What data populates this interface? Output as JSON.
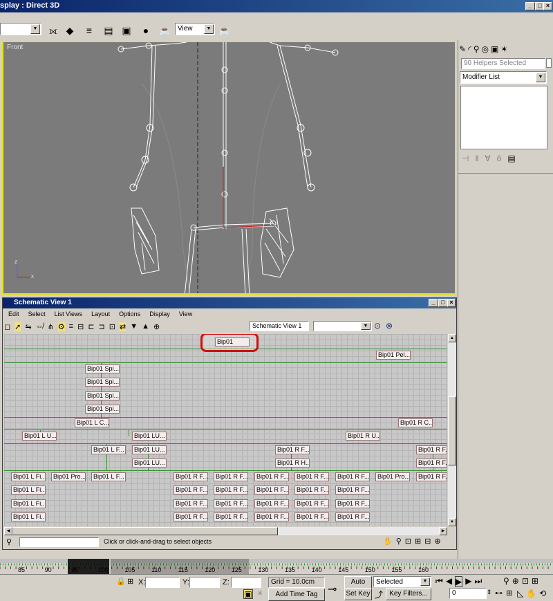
{
  "window": {
    "title": "splay : Direct 3D"
  },
  "toolbar": {
    "view_combo": "View"
  },
  "viewport": {
    "label": "Front",
    "axis_z": "z",
    "axis_x": "x"
  },
  "command_panel": {
    "selection_text": "90 Helpers Selected",
    "modifier_list": "Modifier List"
  },
  "schematic": {
    "title": "Schematic View 1",
    "menu": [
      "Edit",
      "Select",
      "List Views",
      "Layout",
      "Options",
      "Display",
      "View"
    ],
    "view_name": "Schematic View 1",
    "status_text": "Click or click-and-drag to select objects",
    "nodes": {
      "root": "Bip01",
      "pelvis": "Bip01 Pel...",
      "spine1": "Bip01 Spi...",
      "spine2": "Bip01 Spi...",
      "spine3": "Bip01 Spi...",
      "spine4": "Bip01 Spi...",
      "l_clav": "Bip01 L C...",
      "r_clav": "Bip01 R C...",
      "l_upper": "Bip01 L U...",
      "l_lu": "Bip01 LU...",
      "r_upper": "Bip01 R U...",
      "l_f1": "Bip01 L F...",
      "l_lu2": "Bip01 LU...",
      "r_f1": "Bip01 R F...",
      "r_f_far": "Bip01 R F...",
      "l_lu3": "Bip01 LU...",
      "r_h": "Bip01 R H...",
      "r_f_far2": "Bip01 R F...",
      "row1_a": "Bip01 L Fi...",
      "row1_b": "Bip01 Pro...",
      "row1_c": "Bip01 L F...",
      "row1_d": "Bip01 R F...",
      "row1_e": "Bip01 R F...",
      "row1_f": "Bip01 R F...",
      "row1_g": "Bip01 R F...",
      "row1_h": "Bip01 R F...",
      "row1_i": "Bip01 Pro...",
      "row1_j": "Bip01 R F...",
      "row2_a": "Bip01 L Fi...",
      "row2_d": "Bip01 R F...",
      "row2_e": "Bip01 R F...",
      "row2_f": "Bip01 R F...",
      "row2_g": "Bip01 R F...",
      "row2_h": "Bip01 R F...",
      "row3_a": "Bip01 L Fi...",
      "row3_d": "Bip01 R F...",
      "row3_e": "Bip01 R F...",
      "row3_f": "Bip01 R F...",
      "row3_g": "Bip01 R F...",
      "row3_h": "Bip01 R F...",
      "row4_a": "Bip01 L Fi...",
      "row4_d": "Bip01 R F...",
      "row4_e": "Bip01 R F...",
      "row4_f": "Bip01 R F...",
      "row4_g": "Bip01 R F...",
      "row4_h": "Bip01 R F..."
    }
  },
  "timeline": {
    "ticks": [
      "85",
      "90",
      "95",
      "100",
      "105",
      "110",
      "115",
      "120",
      "125",
      "130",
      "135",
      "140",
      "145",
      "150",
      "155",
      "160"
    ]
  },
  "status_bar": {
    "x_label": "X:",
    "y_label": "Y:",
    "z_label": "Z:",
    "grid": "Grid = 10.0cm",
    "add_time_tag": "Add Time Tag",
    "auto_key": "Auto Key",
    "set_key": "Set Key",
    "key_mode": "Selected",
    "key_filters": "Key Filters...",
    "frame": "0"
  },
  "colors": {
    "viewport_bg": "#7b7b7b",
    "active_border": "#e6e600",
    "highlight_ring": "#d01010",
    "link_line": "#2f8f2f"
  }
}
